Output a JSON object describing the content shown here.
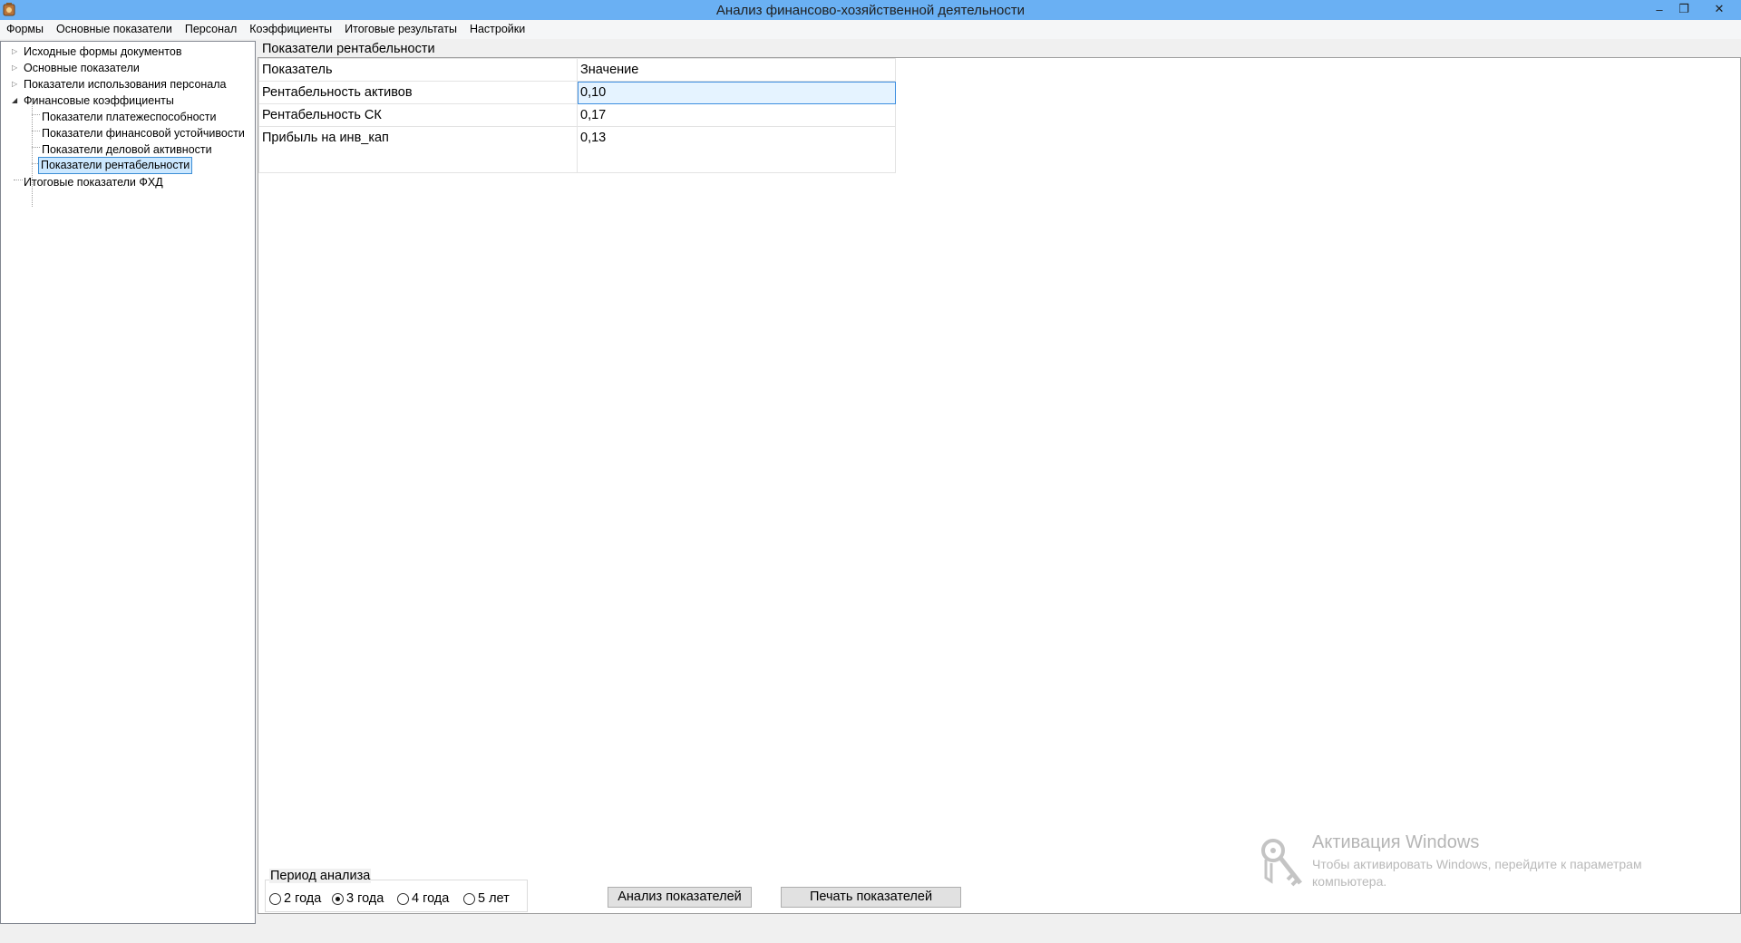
{
  "window": {
    "title": "Анализ финансово-хозяйственной деятельности",
    "minimize_glyph": "‒",
    "restore_glyph": "❐",
    "close_glyph": "✕"
  },
  "menu": [
    "Формы",
    "Основные показатели",
    "Персонал",
    "Коэффициенты",
    "Итоговые результаты",
    "Настройки"
  ],
  "tree": {
    "items": [
      {
        "label": "Исходные формы документов",
        "level": 0,
        "state": "collapsed"
      },
      {
        "label": "Основные показатели",
        "level": 0,
        "state": "collapsed"
      },
      {
        "label": "Показатели  использования персонала",
        "level": 0,
        "state": "collapsed"
      },
      {
        "label": "Финансовые коэффициенты",
        "level": 0,
        "state": "expanded"
      },
      {
        "label": "Показатели платежеспособности",
        "level": 1,
        "state": "leaf"
      },
      {
        "label": "Показатели финансовой устойчивости",
        "level": 1,
        "state": "leaf"
      },
      {
        "label": "Показатели деловой активности",
        "level": 1,
        "state": "leaf"
      },
      {
        "label": "Показатели рентабельности",
        "level": 1,
        "state": "leaf",
        "selected": true
      },
      {
        "label": "Итоговые показатели ФХД",
        "level": 0,
        "state": "leaf"
      }
    ]
  },
  "section": {
    "title": "Показатели рентабельности"
  },
  "grid": {
    "headers": [
      "Показатель",
      "Значение"
    ],
    "rows": [
      {
        "name": "Рентабельность активов",
        "value": "0,10"
      },
      {
        "name": "Рентабельность СК",
        "value": "0,17"
      },
      {
        "name": "Прибыль на инв_кап",
        "value": "0,13"
      }
    ]
  },
  "period": {
    "legend": "Период анализа",
    "options": [
      "2 года",
      "3 года",
      "4 года",
      "5 лет"
    ],
    "selected": "3 года"
  },
  "buttons": {
    "analyze": "Анализ показателей",
    "print": "Печать показателей"
  },
  "watermark": {
    "title": "Активация Windows",
    "text": "Чтобы активировать Windows, перейдите к параметрам компьютера."
  },
  "colors": {
    "titlebar": "#6ab0f3",
    "selection": "#cce8ff",
    "selection_border": "#3c8ed6"
  }
}
